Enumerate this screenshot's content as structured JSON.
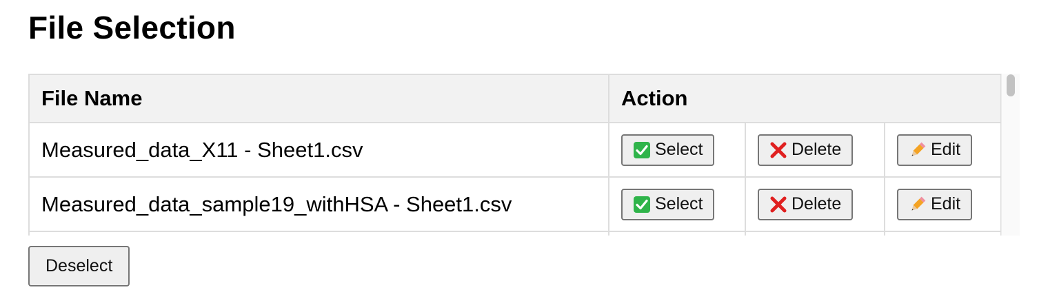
{
  "page": {
    "title": "File Selection"
  },
  "table": {
    "headers": {
      "file_name": "File Name",
      "action": "Action"
    },
    "rows": [
      {
        "file_name": "Measured_data_X11 - Sheet1.csv",
        "select_label": "Select",
        "delete_label": "Delete",
        "edit_label": "Edit"
      },
      {
        "file_name": "Measured_data_sample19_withHSA - Sheet1.csv",
        "select_label": "Select",
        "delete_label": "Delete",
        "edit_label": "Edit"
      }
    ]
  },
  "footer": {
    "deselect_label": "Deselect"
  },
  "icons": {
    "select": "check-mark-icon",
    "delete": "cross-mark-icon",
    "edit": "pencil-icon"
  },
  "colors": {
    "check_green": "#2fb44a",
    "cross_red": "#e02020",
    "header_bg": "#f2f2f2",
    "border": "#dddddd"
  }
}
